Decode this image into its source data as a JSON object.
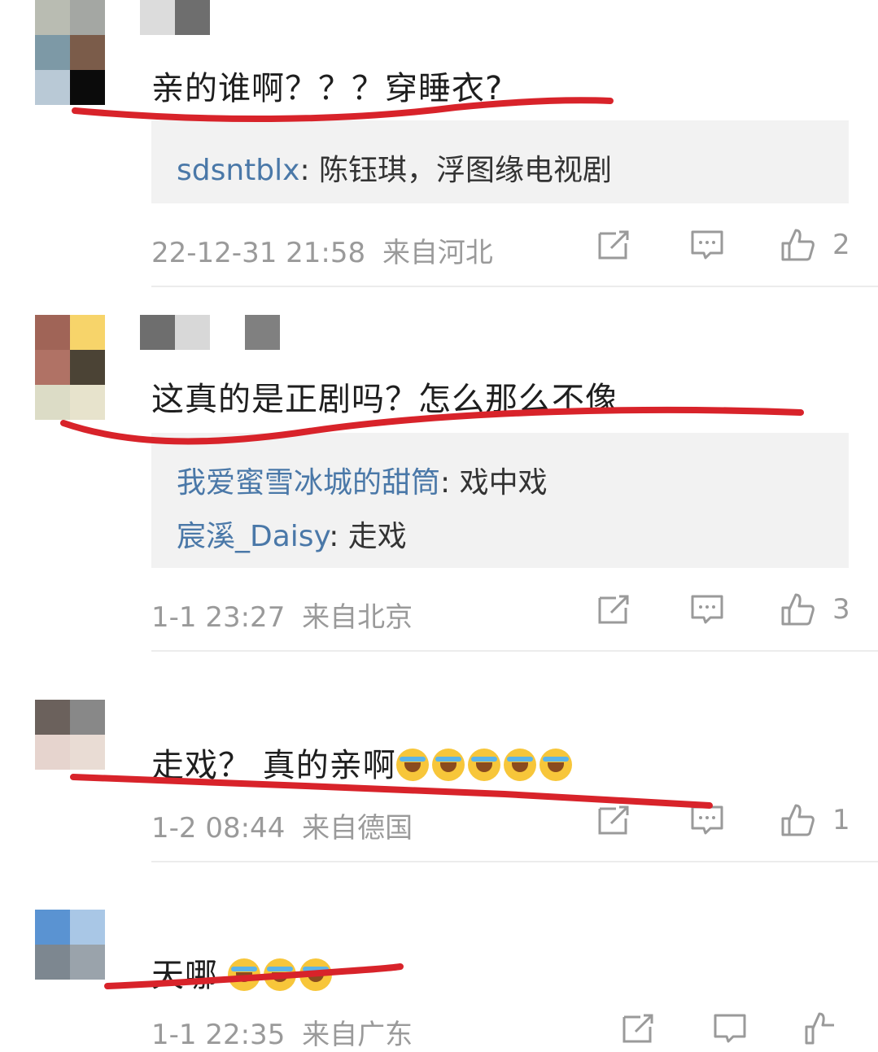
{
  "comments": [
    {
      "text": "亲的谁啊？？？穿睡衣?",
      "replies": [
        {
          "user": "sdsntblx",
          "content": ": 陈钰琪，浮图缘电视剧"
        }
      ],
      "time": "22-12-31 21:58",
      "location": "来自河北",
      "likes": "2"
    },
    {
      "text": "这真的是正剧吗？怎么那么不像",
      "replies": [
        {
          "user": "我爱蜜雪冰城的甜筒",
          "content": ": 戏中戏"
        },
        {
          "user": "宸溪_Daisy",
          "content": ": 走戏"
        }
      ],
      "time": "1-1 23:27",
      "location": "来自北京",
      "likes": "3"
    },
    {
      "text": "走戏？ 真的亲啊",
      "emoji_count": 5,
      "time": "1-2 08:44",
      "location": "来自德国",
      "likes": "1"
    },
    {
      "text": "天哪",
      "emoji_count": 3,
      "time": "1-1 22:35",
      "location": "来自广东"
    }
  ],
  "icons": {
    "repost": "repost-icon",
    "comment": "comment-icon",
    "like": "thumbs-up-icon",
    "emoji": "laughing-crying-emoji"
  },
  "colors": {
    "username": "#4a78a8",
    "meta": "#9a9a9a",
    "reply_bg": "#f2f2f2",
    "annotation_line": "#d8232a"
  }
}
